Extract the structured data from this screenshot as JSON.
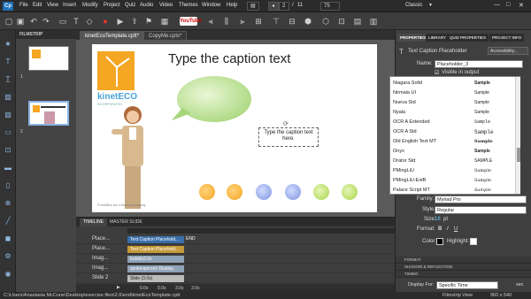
{
  "app": {
    "logo": "Cp",
    "workspace": "Classic"
  },
  "menu": [
    "File",
    "Edit",
    "View",
    "Insert",
    "Modify",
    "Project",
    "Quiz",
    "Audio",
    "Video",
    "Themes",
    "Window",
    "Help"
  ],
  "toolbar": {
    "page_current": "2",
    "page_sep": "/",
    "page_total": "11",
    "zoom": "75",
    "youtube": "YouTube"
  },
  "filmstrip": {
    "title": "FILMSTRIP",
    "slides": [
      "1",
      "2"
    ]
  },
  "doc_tabs": [
    "kinetEcoTemplate.cptt*",
    "CopyMe.cptx*"
  ],
  "slide": {
    "title": "Type the caption text",
    "caption": "Type the caption text here.",
    "logo_text": "kinetECO",
    "logo_sub": "INCORPORATED",
    "footer": "© kinetEco Inc. a fictional company"
  },
  "timeline": {
    "tabs": [
      "TIMELINE",
      "MASTER SLIDE"
    ],
    "rows": [
      {
        "name": "Place...",
        "bar": "Text Caption Placehold..."
      },
      {
        "name": "Place...",
        "bar": "Text Caption Placehold..."
      },
      {
        "name": "Imag...",
        "bar": "bubble2.0s"
      },
      {
        "name": "Imag...",
        "bar": "spokesperson Display..."
      },
      {
        "name": "Slide 2",
        "bar": "Slide (3.0s)"
      }
    ],
    "end_label": "END",
    "times": [
      "0.0s",
      "0.0s",
      "3.0s",
      "3.0s"
    ]
  },
  "properties": {
    "tabs": [
      "PROPERTIES",
      "LIBRARY",
      "QUIZ PROPERTIES",
      "PROJECT INFO"
    ],
    "type": "Text Caption Placeholder",
    "accessibility": "Accessibility...",
    "name_label": "Name:",
    "name_value": "Placeholder_3",
    "visible_label": "Visible in output",
    "font_list": [
      {
        "name": "Niagara Solid",
        "sample": "Sample"
      },
      {
        "name": "Nirmala UI",
        "sample": "Sample"
      },
      {
        "name": "Nueva Std",
        "sample": "Sample"
      },
      {
        "name": "Nyala",
        "sample": "Sample"
      },
      {
        "name": "OCR A Extended",
        "sample": "Sample"
      },
      {
        "name": "OCR A Std",
        "sample": "Sample"
      },
      {
        "name": "Old English Text MT",
        "sample": "Sample"
      },
      {
        "name": "Onyx",
        "sample": "Sample"
      },
      {
        "name": "Orator Std",
        "sample": "SAMPLE"
      },
      {
        "name": "PMingLiU",
        "sample": "Sample"
      },
      {
        "name": "PMingLiU-ExtB",
        "sample": "Sample"
      },
      {
        "name": "Palace Script MT",
        "sample": "Sample"
      }
    ],
    "family_label": "Family:",
    "family_value": "Myriad Pro",
    "style_label": "Style:",
    "style_value": "Regular",
    "size_label": "Size:",
    "size_value": "18",
    "size_unit": "pt",
    "format_label": "Format:",
    "color_label": "Color:",
    "highlight_label": "Highlight:",
    "sections": [
      "FORMAT",
      "SHADOW & REFLECTION",
      "TIMING"
    ],
    "display_for_label": "Display For:",
    "display_for_value": "Specific Time",
    "display_sec": "sec"
  },
  "status": {
    "path": "C:\\Users\\Anastasia McCune\\Desktop\\exercise files\\2.6\\end\\kinetEcoTemplate.cptt",
    "view": "Filmstrip View",
    "size": "960 x 540"
  },
  "colors": {
    "accent": "#8ab4e6",
    "bubble": "#b6e38d",
    "logo_orange": "#f5a623",
    "dot_orange": "#f5a623",
    "dot_blue": "#7f93e0",
    "dot_green": "#a8d64a"
  }
}
